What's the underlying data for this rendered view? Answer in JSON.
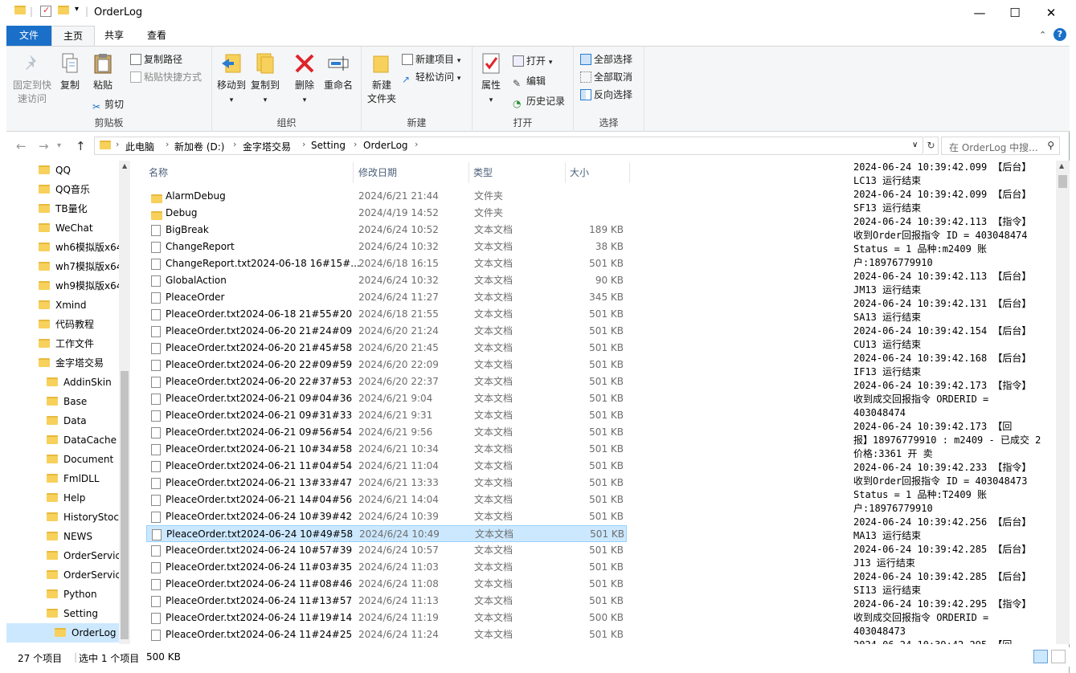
{
  "window": {
    "title": "OrderLog",
    "minimize": "—",
    "maximize": "☐",
    "close": "✕"
  },
  "tabs": [
    "文件",
    "主页",
    "共享",
    "查看"
  ],
  "ribbon": {
    "clipboard": {
      "pin": "固定到快\n速访问",
      "copy": "复制",
      "paste": "粘贴",
      "copy_path": "复制路径",
      "paste_shortcut": "粘贴快捷方式",
      "cut": "剪切",
      "label": "剪贴板"
    },
    "organize": {
      "move_to": "移动到",
      "copy_to": "复制到",
      "delete": "删除",
      "rename": "重命名",
      "label": "组织"
    },
    "new": {
      "new_folder": "新建\n文件夹",
      "new_item": "新建项目",
      "easy_access": "轻松访问",
      "label": "新建"
    },
    "open": {
      "properties": "属性",
      "open": "打开",
      "edit": "编辑",
      "history": "历史记录",
      "label": "打开"
    },
    "select": {
      "select_all": "全部选择",
      "select_none": "全部取消",
      "invert": "反向选择",
      "label": "选择"
    }
  },
  "address": {
    "crumbs": [
      "此电脑",
      "新加卷 (D:)",
      "金字塔交易",
      "Setting",
      "OrderLog"
    ],
    "search_placeholder": "在 OrderLog 中搜..."
  },
  "sidebar": {
    "items": [
      {
        "label": "QQ",
        "indent": 0
      },
      {
        "label": "QQ音乐",
        "indent": 0
      },
      {
        "label": "TB量化",
        "indent": 0
      },
      {
        "label": "WeChat",
        "indent": 0
      },
      {
        "label": "wh6模拟版x64",
        "indent": 0
      },
      {
        "label": "wh7模拟版x64",
        "indent": 0
      },
      {
        "label": "wh9模拟版x64",
        "indent": 0
      },
      {
        "label": "Xmind",
        "indent": 0
      },
      {
        "label": "代码教程",
        "indent": 0
      },
      {
        "label": "工作文件",
        "indent": 0
      },
      {
        "label": "金字塔交易",
        "indent": 0
      },
      {
        "label": "AddinSkin",
        "indent": 1
      },
      {
        "label": "Base",
        "indent": 1
      },
      {
        "label": "Data",
        "indent": 1
      },
      {
        "label": "DataCache",
        "indent": 1
      },
      {
        "label": "Document",
        "indent": 1
      },
      {
        "label": "FmlDLL",
        "indent": 1
      },
      {
        "label": "Help",
        "indent": 1
      },
      {
        "label": "HistoryStock",
        "indent": 1
      },
      {
        "label": "NEWS",
        "indent": 1
      },
      {
        "label": "OrderService",
        "indent": 1
      },
      {
        "label": "OrderService",
        "indent": 1
      },
      {
        "label": "Python",
        "indent": 1
      },
      {
        "label": "Setting",
        "indent": 1
      },
      {
        "label": "OrderLog",
        "indent": 2,
        "selected": true
      }
    ]
  },
  "columns": {
    "name": "名称",
    "date": "修改日期",
    "type": "类型",
    "size": "大小"
  },
  "files": [
    {
      "name": "AlarmDebug",
      "date": "2024/6/21 21:44",
      "type": "文件夹",
      "size": "",
      "kind": "folder"
    },
    {
      "name": "Debug",
      "date": "2024/4/19 14:52",
      "type": "文件夹",
      "size": "",
      "kind": "folder"
    },
    {
      "name": "BigBreak",
      "date": "2024/6/24 10:52",
      "type": "文本文档",
      "size": "189 KB",
      "kind": "doc"
    },
    {
      "name": "ChangeReport",
      "date": "2024/6/24 10:32",
      "type": "文本文档",
      "size": "38 KB",
      "kind": "doc"
    },
    {
      "name": "ChangeReport.txt2024-06-18 16#15#...",
      "date": "2024/6/18 16:15",
      "type": "文本文档",
      "size": "501 KB",
      "kind": "doc"
    },
    {
      "name": "GlobalAction",
      "date": "2024/6/24 10:32",
      "type": "文本文档",
      "size": "90 KB",
      "kind": "doc"
    },
    {
      "name": "PleaceOrder",
      "date": "2024/6/24 11:27",
      "type": "文本文档",
      "size": "345 KB",
      "kind": "doc"
    },
    {
      "name": "PleaceOrder.txt2024-06-18 21#55#20",
      "date": "2024/6/18 21:55",
      "type": "文本文档",
      "size": "501 KB",
      "kind": "doc"
    },
    {
      "name": "PleaceOrder.txt2024-06-20 21#24#09",
      "date": "2024/6/20 21:24",
      "type": "文本文档",
      "size": "501 KB",
      "kind": "doc"
    },
    {
      "name": "PleaceOrder.txt2024-06-20 21#45#58",
      "date": "2024/6/20 21:45",
      "type": "文本文档",
      "size": "501 KB",
      "kind": "doc"
    },
    {
      "name": "PleaceOrder.txt2024-06-20 22#09#59",
      "date": "2024/6/20 22:09",
      "type": "文本文档",
      "size": "501 KB",
      "kind": "doc"
    },
    {
      "name": "PleaceOrder.txt2024-06-20 22#37#53",
      "date": "2024/6/20 22:37",
      "type": "文本文档",
      "size": "501 KB",
      "kind": "doc"
    },
    {
      "name": "PleaceOrder.txt2024-06-21 09#04#36",
      "date": "2024/6/21 9:04",
      "type": "文本文档",
      "size": "501 KB",
      "kind": "doc"
    },
    {
      "name": "PleaceOrder.txt2024-06-21 09#31#33",
      "date": "2024/6/21 9:31",
      "type": "文本文档",
      "size": "501 KB",
      "kind": "doc"
    },
    {
      "name": "PleaceOrder.txt2024-06-21 09#56#54",
      "date": "2024/6/21 9:56",
      "type": "文本文档",
      "size": "501 KB",
      "kind": "doc"
    },
    {
      "name": "PleaceOrder.txt2024-06-21 10#34#58",
      "date": "2024/6/21 10:34",
      "type": "文本文档",
      "size": "501 KB",
      "kind": "doc"
    },
    {
      "name": "PleaceOrder.txt2024-06-21 11#04#54",
      "date": "2024/6/21 11:04",
      "type": "文本文档",
      "size": "501 KB",
      "kind": "doc"
    },
    {
      "name": "PleaceOrder.txt2024-06-21 13#33#47",
      "date": "2024/6/21 13:33",
      "type": "文本文档",
      "size": "501 KB",
      "kind": "doc"
    },
    {
      "name": "PleaceOrder.txt2024-06-21 14#04#56",
      "date": "2024/6/21 14:04",
      "type": "文本文档",
      "size": "501 KB",
      "kind": "doc"
    },
    {
      "name": "PleaceOrder.txt2024-06-24 10#39#42",
      "date": "2024/6/24 10:39",
      "type": "文本文档",
      "size": "501 KB",
      "kind": "doc"
    },
    {
      "name": "PleaceOrder.txt2024-06-24 10#49#58",
      "date": "2024/6/24 10:49",
      "type": "文本文档",
      "size": "501 KB",
      "kind": "doc",
      "selected": true
    },
    {
      "name": "PleaceOrder.txt2024-06-24 10#57#39",
      "date": "2024/6/24 10:57",
      "type": "文本文档",
      "size": "501 KB",
      "kind": "doc"
    },
    {
      "name": "PleaceOrder.txt2024-06-24 11#03#35",
      "date": "2024/6/24 11:03",
      "type": "文本文档",
      "size": "501 KB",
      "kind": "doc"
    },
    {
      "name": "PleaceOrder.txt2024-06-24 11#08#46",
      "date": "2024/6/24 11:08",
      "type": "文本文档",
      "size": "501 KB",
      "kind": "doc"
    },
    {
      "name": "PleaceOrder.txt2024-06-24 11#13#57",
      "date": "2024/6/24 11:13",
      "type": "文本文档",
      "size": "501 KB",
      "kind": "doc"
    },
    {
      "name": "PleaceOrder.txt2024-06-24 11#19#14",
      "date": "2024/6/24 11:19",
      "type": "文本文档",
      "size": "500 KB",
      "kind": "doc"
    },
    {
      "name": "PleaceOrder.txt2024-06-24 11#24#25",
      "date": "2024/6/24 11:24",
      "type": "文本文档",
      "size": "501 KB",
      "kind": "doc"
    }
  ],
  "log_lines": [
    "2024-06-24 10:39:42.099   【后台】",
    "LC13 运行结束",
    "2024-06-24 10:39:42.099   【后台】",
    "SF13 运行结束",
    "2024-06-24 10:39:42.113   【指令】",
    "收到Order回报指令 ID = 403048474",
    "Status = 1 品种:m2409 账",
    "户:18976779910",
    "2024-06-24 10:39:42.113   【后台】",
    "JM13 运行结束",
    "2024-06-24 10:39:42.131   【后台】",
    "SA13 运行结束",
    "2024-06-24 10:39:42.154   【后台】",
    "CU13 运行结束",
    "2024-06-24 10:39:42.168   【后台】",
    "IF13 运行结束",
    "2024-06-24 10:39:42.173   【指令】",
    "收到成交回报指令 ORDERID =",
    "403048474",
    "2024-06-24 10:39:42.173   【回",
    "报】18976779910 : m2409 - 已成交 2",
    "价格:3361 开 卖",
    "2024-06-24 10:39:42.233   【指令】",
    "收到Order回报指令 ID = 403048473",
    "Status = 1 品种:T2409 账",
    "户:18976779910",
    "2024-06-24 10:39:42.256   【后台】",
    "MA13 运行结束",
    "2024-06-24 10:39:42.285   【后台】",
    "J13 运行结束",
    "2024-06-24 10:39:42.285   【后台】",
    "SI13 运行结束",
    "2024-06-24 10:39:42.295   【指令】",
    "收到成交回报指令 ORDERID =",
    "403048473",
    "2024-06-24 10:39:42.295   【回"
  ],
  "status": {
    "count": "27 个项目",
    "selected": "选中 1 个项目",
    "size": "500 KB"
  },
  "colors": {
    "accent": "#1a6fc9",
    "selection": "#cce8ff",
    "folder": "#f7d15c"
  }
}
